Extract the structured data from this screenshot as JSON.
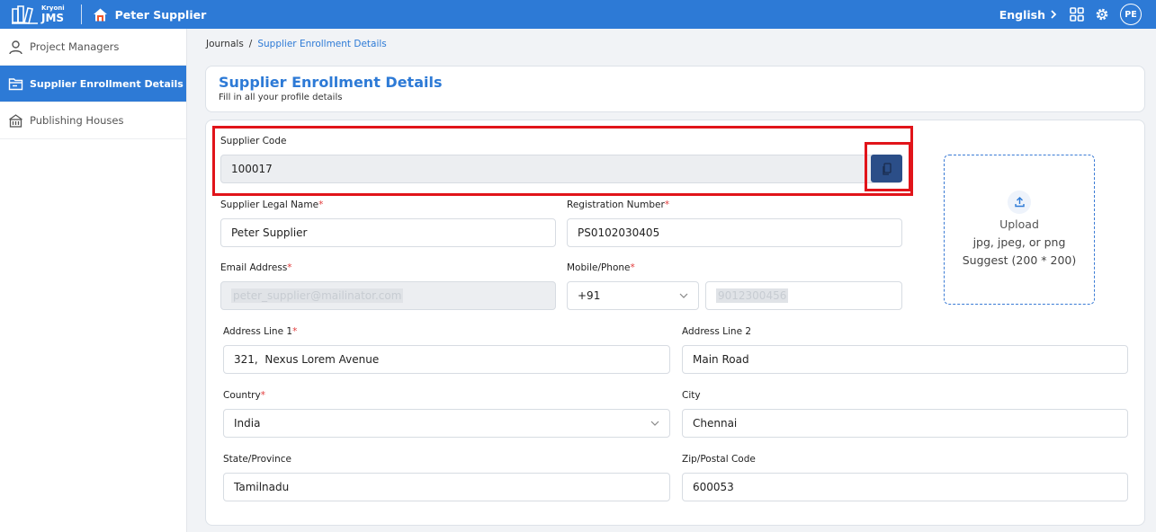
{
  "topbar": {
    "brand_small": "Kryoni",
    "brand_big": "JMS",
    "supplier_name": "Peter Supplier",
    "language": "English",
    "avatar_initials": "PE"
  },
  "sidebar": {
    "items": [
      {
        "label": "Project Managers",
        "icon": "person-icon"
      },
      {
        "label": "Supplier Enrollment Details",
        "icon": "folder-icon"
      },
      {
        "label": "Publishing Houses",
        "icon": "building-icon"
      }
    ]
  },
  "breadcrumb": {
    "root": "Journals",
    "sep": "/",
    "current": "Supplier Enrollment Details"
  },
  "header": {
    "title": "Supplier Enrollment Details",
    "subtitle": "Fill in all your profile details"
  },
  "form": {
    "supplier_code": {
      "label": "Supplier Code",
      "value": "100017"
    },
    "legal_name": {
      "label": "Supplier Legal Name",
      "value": "Peter Supplier"
    },
    "registration": {
      "label": "Registration Number",
      "value": "PS0102030405"
    },
    "email": {
      "label": "Email Address",
      "value": "peter_supplier@mailinator.com"
    },
    "mobile": {
      "label": "Mobile/Phone",
      "code": "+91",
      "value": "9012300456"
    },
    "address1": {
      "label": "Address Line 1",
      "value": "321,  Nexus Lorem Avenue"
    },
    "address2": {
      "label": "Address Line 2",
      "value": "Main Road"
    },
    "country": {
      "label": "Country",
      "value": "India"
    },
    "city": {
      "label": "City",
      "value": "Chennai"
    },
    "state": {
      "label": "State/Province",
      "value": "Tamilnadu"
    },
    "zip": {
      "label": "Zip/Postal Code",
      "value": "600053"
    },
    "required_mark": "*"
  },
  "upload": {
    "title": "Upload",
    "types": "jpg, jpeg, or png",
    "suggest": "Suggest (200 * 200)"
  },
  "colors": {
    "primary": "#2d7ad6",
    "highlight": "#e1141a",
    "copy_button": "#2b4e88",
    "required": "#e23b3b"
  }
}
